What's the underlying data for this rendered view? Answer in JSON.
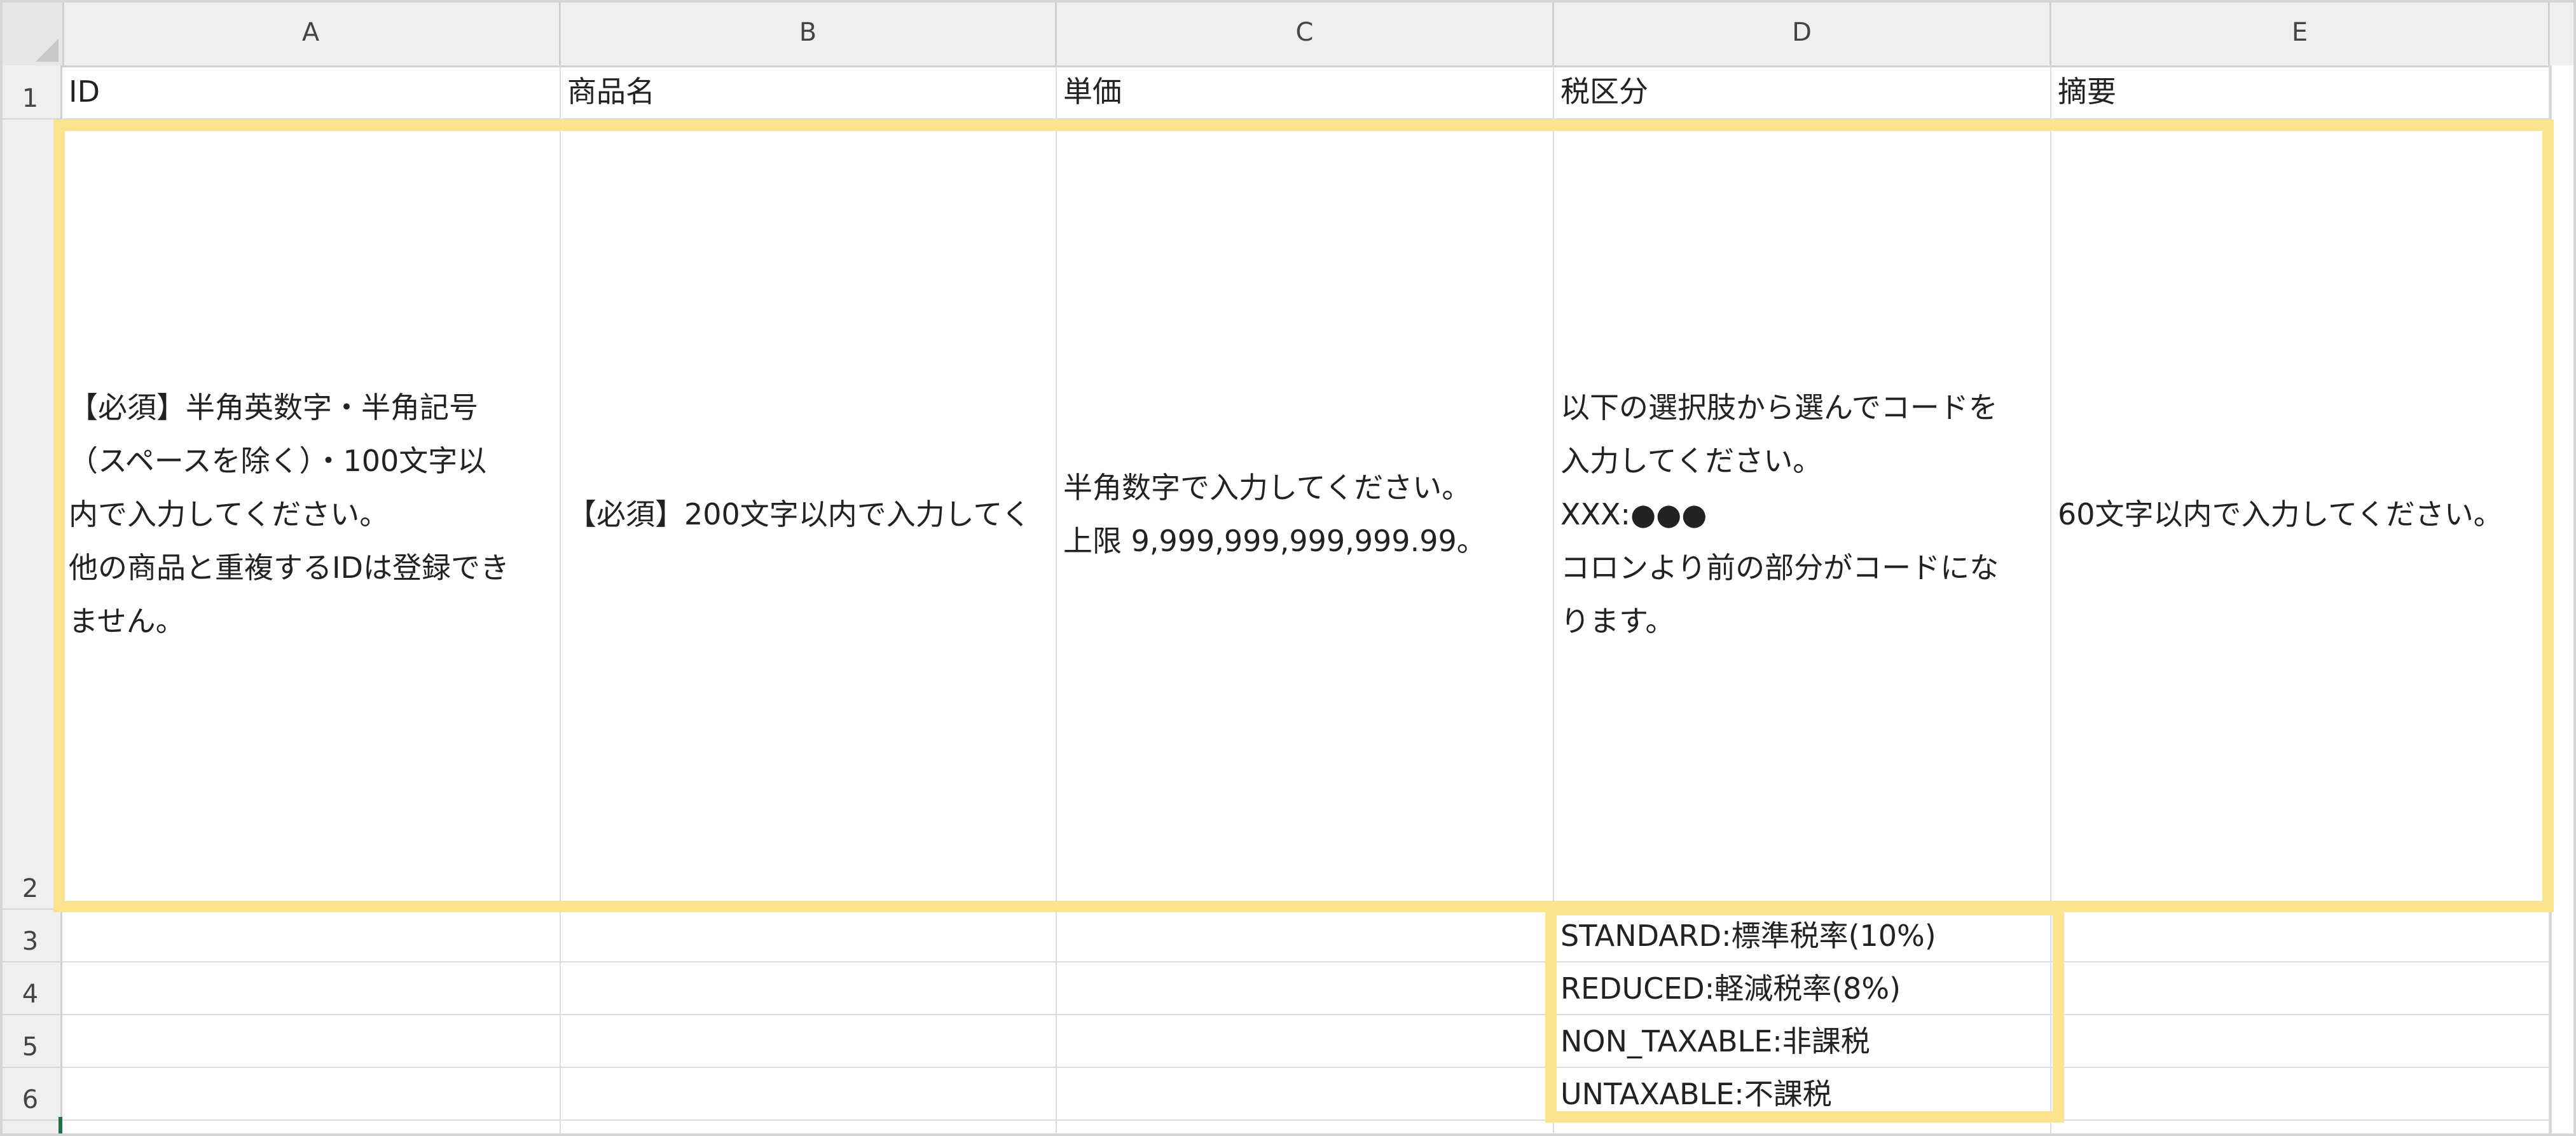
{
  "columns": [
    "A",
    "B",
    "C",
    "D",
    "E"
  ],
  "rows": [
    "1",
    "2",
    "3",
    "4",
    "5",
    "6"
  ],
  "header_row": {
    "a": "ID",
    "b": "商品名",
    "c": "単価",
    "d": "税区分",
    "e": "摘要"
  },
  "description_row": {
    "a": "【必須】半角英数字・半角記号\n（スペースを除く）・100文字以\n内で入力してください。\n他の商品と重複するIDは登録でき\nません。",
    "b": "【必須】200文字以内で入力してく",
    "c": "半角数字で入力してください。\n上限 9,999,999,999,999.99。",
    "d": "以下の選択肢から選んでコードを\n入力してください。\nXXX:●●●\nコロンより前の部分がコードにな\nります。",
    "e": "60文字以内で入力してください。"
  },
  "tax_options": [
    "STANDARD:標準税率(10%)",
    "REDUCED:軽減税率(8%)",
    "NON_TAXABLE:非課税",
    "UNTAXABLE:不課税"
  ],
  "colors": {
    "highlight": "#fbe38f",
    "header_bg": "#efefef",
    "grid": "#dcdcdc",
    "active_cell_marker": "#1e7145"
  }
}
